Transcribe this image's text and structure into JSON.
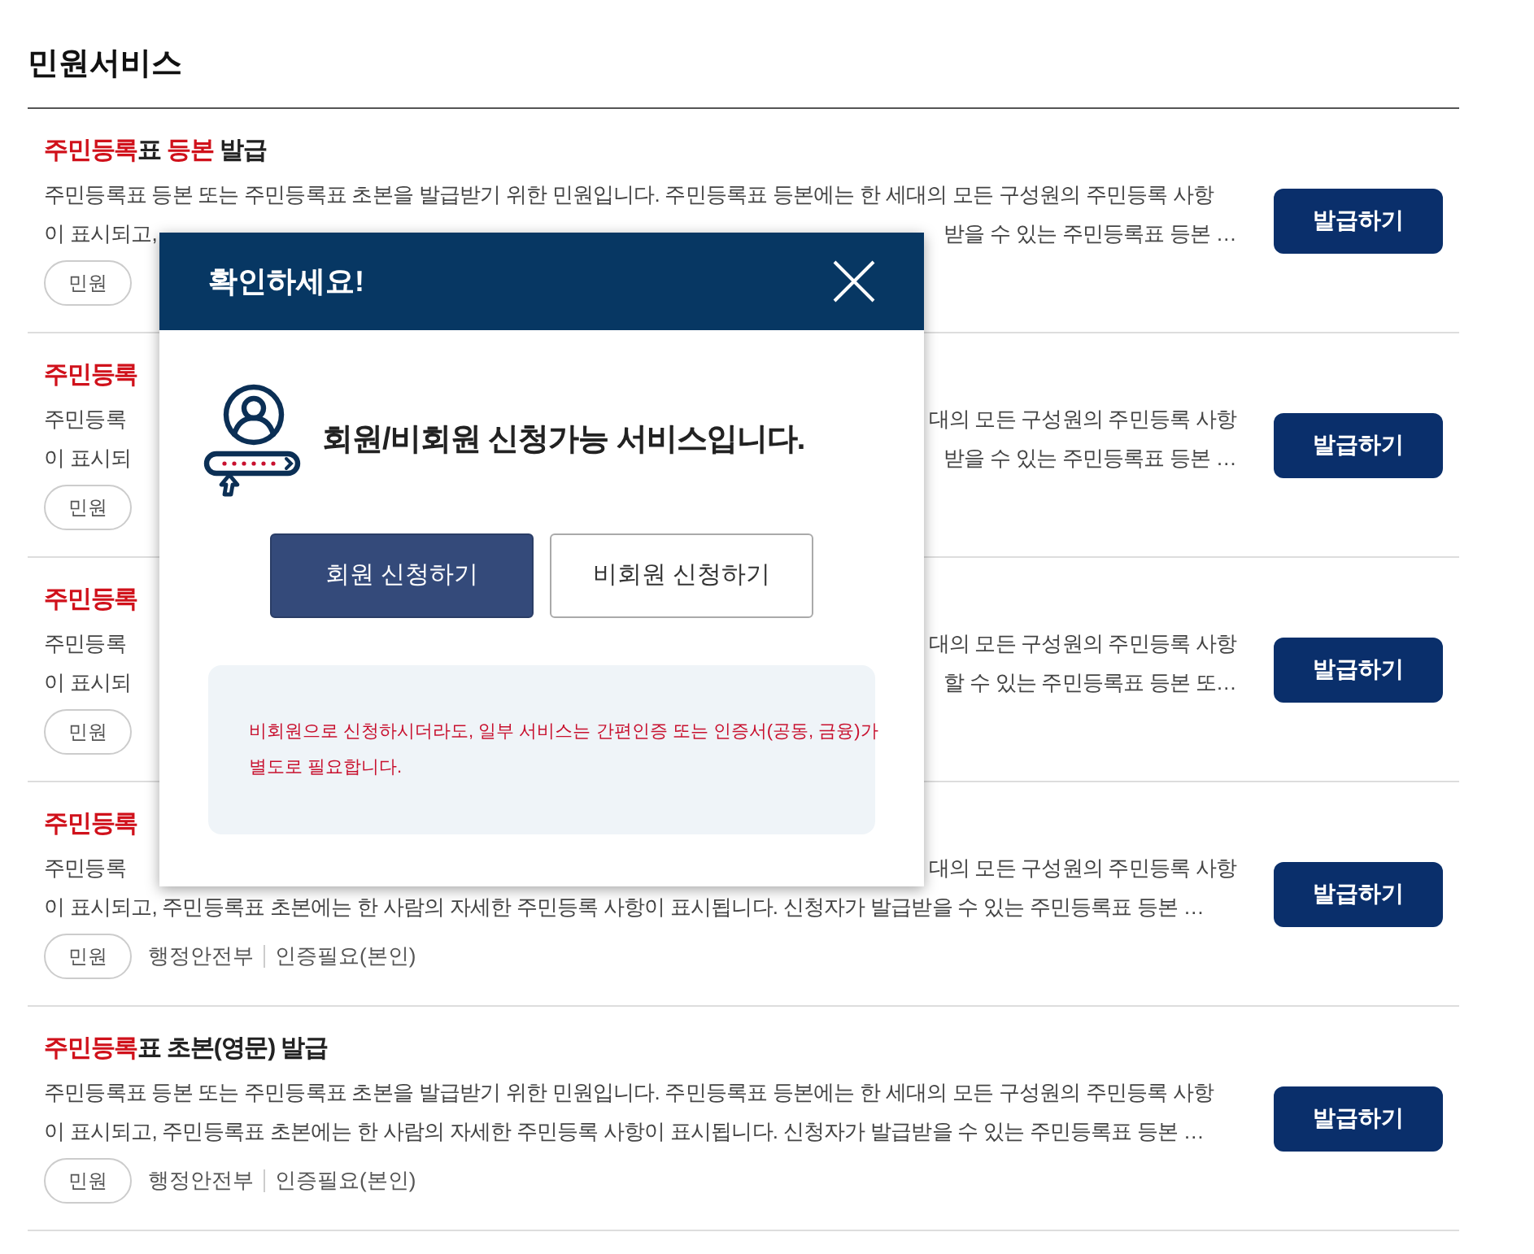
{
  "page_title": "민원서비스",
  "services": [
    {
      "title": [
        {
          "text": "주민등록",
          "highlight": true
        },
        {
          "text": "표 ",
          "highlight": false
        },
        {
          "text": "등본",
          "highlight": true
        },
        {
          "text": " 발급",
          "highlight": false
        }
      ],
      "lines": [
        {
          "kind": "full",
          "text": "주민등록표 등본 또는 주민등록표 초본을 발급받기 위한 민원입니다. 주민등록표 등본에는 한 세대의 모든 구성원의 주민등록 사항"
        },
        {
          "kind": "split",
          "left": "이 표시되고,",
          "right": "받을 수 있는 주민등록표 등본 …"
        }
      ],
      "tags": [
        {
          "kind": "pill",
          "text": "민원"
        }
      ],
      "button": "발급하기"
    },
    {
      "title": [
        {
          "text": "주민등록",
          "highlight": true
        }
      ],
      "lines": [
        {
          "kind": "split",
          "left": "주민등록",
          "right": "대의 모든 구성원의 주민등록 사항"
        },
        {
          "kind": "split",
          "left": "이 표시되",
          "right": "받을 수 있는 주민등록표 등본 …"
        }
      ],
      "tags": [
        {
          "kind": "pill",
          "text": "민원"
        }
      ],
      "button": "발급하기"
    },
    {
      "title": [
        {
          "text": "주민등록",
          "highlight": true
        }
      ],
      "lines": [
        {
          "kind": "split",
          "left": "주민등록",
          "right": "대의 모든 구성원의 주민등록 사항"
        },
        {
          "kind": "split",
          "left": "이 표시되",
          "right": "할 수 있는 주민등록표 등본 또…"
        }
      ],
      "tags": [
        {
          "kind": "pill",
          "text": "민원"
        }
      ],
      "button": "발급하기"
    },
    {
      "title": [
        {
          "text": "주민등록",
          "highlight": true
        }
      ],
      "lines": [
        {
          "kind": "split",
          "left": "주민등록",
          "right": "대의 모든 구성원의 주민등록 사항"
        },
        {
          "kind": "full",
          "text": "이 표시되고, 주민등록표 초본에는 한 사람의 자세한 주민등록 사항이 표시됩니다. 신청자가 발급받을 수 있는 주민등록표 등본 …"
        }
      ],
      "tags": [
        {
          "kind": "pill",
          "text": "민원"
        },
        {
          "kind": "plain",
          "text": "행정안전부"
        },
        {
          "kind": "plain",
          "text": "인증필요(본인)"
        }
      ],
      "button": "발급하기"
    },
    {
      "title": [
        {
          "text": "주민등록",
          "highlight": true
        },
        {
          "text": "표 초본(영문) 발급",
          "highlight": false
        }
      ],
      "lines": [
        {
          "kind": "full",
          "text": "주민등록표 등본 또는 주민등록표 초본을 발급받기 위한 민원입니다. 주민등록표 등본에는 한 세대의 모든 구성원의 주민등록 사항"
        },
        {
          "kind": "full",
          "text": "이 표시되고, 주민등록표 초본에는 한 사람의 자세한 주민등록 사항이 표시됩니다. 신청자가 발급받을 수 있는 주민등록표 등본 …"
        }
      ],
      "tags": [
        {
          "kind": "pill",
          "text": "민원"
        },
        {
          "kind": "plain",
          "text": "행정안전부"
        },
        {
          "kind": "plain",
          "text": "인증필요(본인)"
        }
      ],
      "button": "발급하기"
    }
  ],
  "dialog": {
    "title": "확인하세요!",
    "message": "회원/비회원 신청가능 서비스입니다.",
    "buttons": [
      {
        "label": "회원 신청하기",
        "kind": "primary"
      },
      {
        "label": "비회원 신청하기",
        "kind": "secondary"
      }
    ],
    "notice": [
      "비회원으로 신청하시더라도, 일부 서비스는 간편인증 또는 인증서(공동, 금융)가",
      "별도로 필요합니다."
    ]
  }
}
